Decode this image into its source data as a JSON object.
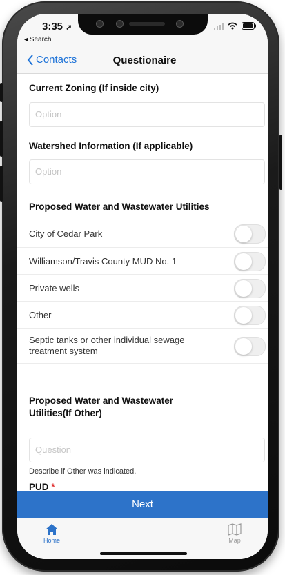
{
  "status": {
    "time": "3:35",
    "back_app": "◂ Search"
  },
  "nav": {
    "back_label": "Contacts",
    "title": "Questionaire"
  },
  "form": {
    "zoning_title": "Current Zoning (If inside city)",
    "zoning_placeholder": "Option",
    "watershed_title": "Watershed Information (If applicable)",
    "watershed_placeholder": "Option",
    "utilities_title": "Proposed Water and Wastewater Utilities",
    "utilities_options": [
      {
        "label": "City of Cedar Park",
        "on": false
      },
      {
        "label": "Williamson/Travis County MUD No. 1",
        "on": false
      },
      {
        "label": "Private wells",
        "on": false
      },
      {
        "label": "Other",
        "on": false
      },
      {
        "label": "Septic tanks or other individual sewage treatment system",
        "on": false
      }
    ],
    "other_title": "Proposed Water and Wastewater Utilities(If Other)",
    "other_placeholder": "Question",
    "other_helper": "Describe if Other was indicated.",
    "pud_label": "PUD",
    "required_mark": "*"
  },
  "actions": {
    "next_label": "Next"
  },
  "tabbar": {
    "home_label": "Home",
    "map_label": "Map"
  },
  "colors": {
    "accent": "#1e73d8",
    "button": "#2d73c9",
    "required": "#e03131"
  }
}
